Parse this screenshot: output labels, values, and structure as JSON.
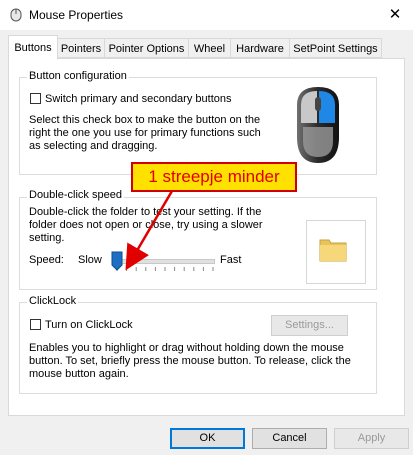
{
  "window": {
    "title": "Mouse Properties",
    "close_symbol": "✕"
  },
  "tabs": [
    {
      "label": "Buttons",
      "active": true
    },
    {
      "label": "Pointers"
    },
    {
      "label": "Pointer Options"
    },
    {
      "label": "Wheel"
    },
    {
      "label": "Hardware"
    },
    {
      "label": "SetPoint Settings"
    }
  ],
  "button_configuration": {
    "title": "Button configuration",
    "checkbox_label": "Switch primary and secondary buttons",
    "checked": false,
    "description_lines": [
      "Select this check box to make the button on the",
      "right the one you use for primary functions such",
      "as selecting and dragging."
    ],
    "icon": "mouse-icon"
  },
  "double_click": {
    "title": "Double-click speed",
    "description_lines": [
      "Double-click the folder to test your setting. If the",
      "folder does not open or close, try using a slower",
      "setting."
    ],
    "speed_label": "Speed:",
    "slow_label": "Slow",
    "fast_label": "Fast",
    "slider_value_fraction": 0.0,
    "icon": "folder-icon"
  },
  "clicklock": {
    "title": "ClickLock",
    "checkbox_label": "Turn on ClickLock",
    "checked": false,
    "settings_button": "Settings...",
    "description_lines": [
      "Enables you to highlight or drag without holding down the mouse",
      "button. To set, briefly press the mouse button. To release, click the",
      "mouse button again."
    ]
  },
  "footer": {
    "ok": "OK",
    "cancel": "Cancel",
    "apply": "Apply"
  },
  "annotation": {
    "text": "1 streepje minder",
    "fill_color": "#ffe100",
    "border_color": "#d10000",
    "text_color": "#e00000"
  },
  "colors": {
    "accent": "#0078d7",
    "slider_thumb": "#1e6fc4"
  }
}
